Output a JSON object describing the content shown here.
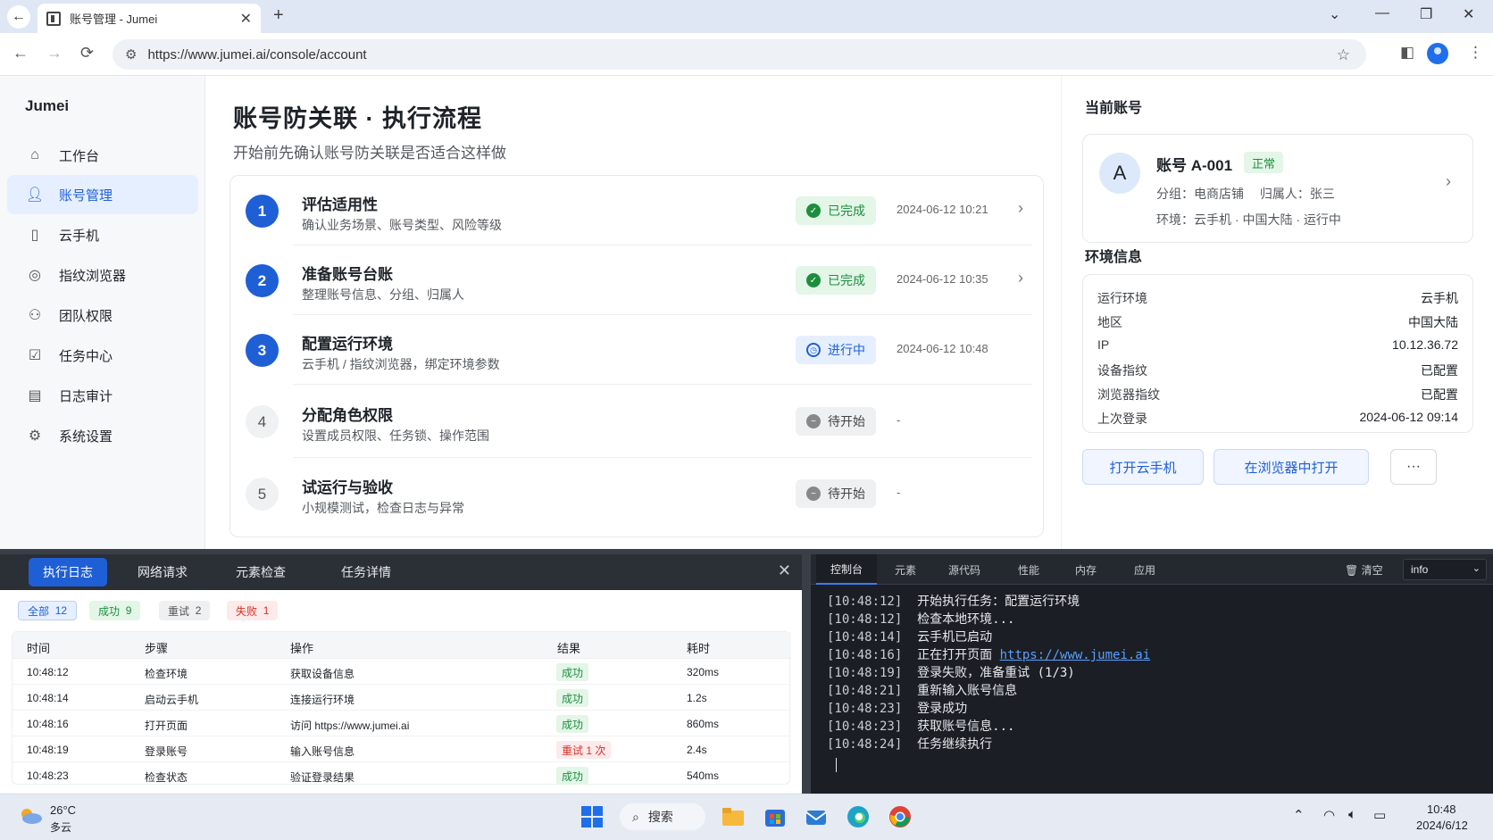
{
  "browser": {
    "tab_title": "账号管理 - Jumei",
    "url": "https://www.jumei.ai/console/account"
  },
  "sidebar": {
    "brand": "Jumei",
    "items": [
      {
        "label": "工作台",
        "icon": "home-icon"
      },
      {
        "label": "账号管理",
        "icon": "user-icon",
        "active": true
      },
      {
        "label": "云手机",
        "icon": "phone-icon"
      },
      {
        "label": "指纹浏览器",
        "icon": "fingerprint-icon"
      },
      {
        "label": "团队权限",
        "icon": "team-icon"
      },
      {
        "label": "任务中心",
        "icon": "task-icon"
      },
      {
        "label": "日志审计",
        "icon": "log-icon"
      },
      {
        "label": "系统设置",
        "icon": "gear-icon"
      }
    ]
  },
  "main": {
    "title": "账号防关联 · 执行流程",
    "subtitle": "开始前先确认账号防关联是否适合这样做",
    "steps": [
      {
        "num": "1",
        "title": "评估适用性",
        "desc": "确认业务场景、账号类型、风险等级",
        "status": "已完成",
        "state": "done",
        "time": "2024-06-12 10:21"
      },
      {
        "num": "2",
        "title": "准备账号台账",
        "desc": "整理账号信息、分组、归属人",
        "status": "已完成",
        "state": "done",
        "time": "2024-06-12 10:35"
      },
      {
        "num": "3",
        "title": "配置运行环境",
        "desc": "云手机 / 指纹浏览器，绑定环境参数",
        "status": "进行中",
        "state": "doing",
        "time": "2024-06-12 10:48"
      },
      {
        "num": "4",
        "title": "分配角色权限",
        "desc": "设置成员权限、任务锁、操作范围",
        "status": "待开始",
        "state": "todo",
        "time": "-"
      },
      {
        "num": "5",
        "title": "试运行与验收",
        "desc": "小规模测试，检查日志与异常",
        "status": "待开始",
        "state": "todo",
        "time": "-"
      }
    ]
  },
  "account": {
    "section_title": "当前账号",
    "avatar": "A",
    "name": "账号 A-001",
    "status": "正常",
    "group_line": "分组：电商店铺　 归属人：张三",
    "env_line": "环境：云手机 · 中国大陆 · 运行中"
  },
  "env": {
    "section_title": "环境信息",
    "rows": [
      {
        "label": "运行环境",
        "value": "云手机"
      },
      {
        "label": "地区",
        "value": "中国大陆"
      },
      {
        "label": "IP",
        "value": "10.12.36.72"
      },
      {
        "label": "设备指纹",
        "value": "已配置"
      },
      {
        "label": "浏览器指纹",
        "value": "已配置"
      },
      {
        "label": "上次登录",
        "value": "2024-06-12 09:14"
      }
    ],
    "btn_open_phone": "打开云手机",
    "btn_open_browser": "在浏览器中打开",
    "btn_more": "···"
  },
  "log_panel": {
    "tabs": [
      "执行日志",
      "网络请求",
      "元素检查",
      "任务详情"
    ],
    "filters": [
      {
        "label": "全部",
        "count": "12"
      },
      {
        "label": "成功",
        "count": "9"
      },
      {
        "label": "重试",
        "count": "2"
      },
      {
        "label": "失败",
        "count": "1"
      }
    ],
    "columns": [
      "时间",
      "步骤",
      "操作",
      "结果",
      "耗时"
    ],
    "rows": [
      {
        "time": "10:48:12",
        "step": "检查环境",
        "op": "获取设备信息",
        "result": "成功",
        "kind": "ok",
        "cost": "320ms"
      },
      {
        "time": "10:48:14",
        "step": "启动云手机",
        "op": "连接运行环境",
        "result": "成功",
        "kind": "ok",
        "cost": "1.2s"
      },
      {
        "time": "10:48:16",
        "step": "打开页面",
        "op": "访问 https://www.jumei.ai",
        "result": "成功",
        "kind": "ok",
        "cost": "860ms"
      },
      {
        "time": "10:48:19",
        "step": "登录账号",
        "op": "输入账号信息",
        "result": "重试 1 次",
        "kind": "retry",
        "cost": "2.4s"
      },
      {
        "time": "10:48:23",
        "step": "检查状态",
        "op": "验证登录结果",
        "result": "成功",
        "kind": "ok",
        "cost": "540ms"
      }
    ]
  },
  "console": {
    "tabs": [
      "控制台",
      "元素",
      "源代码",
      "性能",
      "内存",
      "应用"
    ],
    "clear_label": "清空",
    "level": "info",
    "lines": [
      {
        "ts": "[10:48:12]",
        "msg": "开始执行任务：配置运行环境"
      },
      {
        "ts": "[10:48:12]",
        "msg": "检查本地环境..."
      },
      {
        "ts": "[10:48:14]",
        "msg": "云手机已启动"
      },
      {
        "ts": "[10:48:16]",
        "msg": "正在打开页面 ",
        "link": "https://www.jumei.ai"
      },
      {
        "ts": "[10:48:19]",
        "msg": "登录失败，准备重试 (1/3)"
      },
      {
        "ts": "[10:48:21]",
        "msg": "重新输入账号信息"
      },
      {
        "ts": "[10:48:23]",
        "msg": "登录成功"
      },
      {
        "ts": "[10:48:23]",
        "msg": "获取账号信息..."
      },
      {
        "ts": "[10:48:24]",
        "msg": "任务继续执行"
      }
    ]
  },
  "taskbar": {
    "temp": "26°C",
    "weather": "多云",
    "search": "搜索",
    "time": "10:48",
    "date": "2024/6/12"
  }
}
